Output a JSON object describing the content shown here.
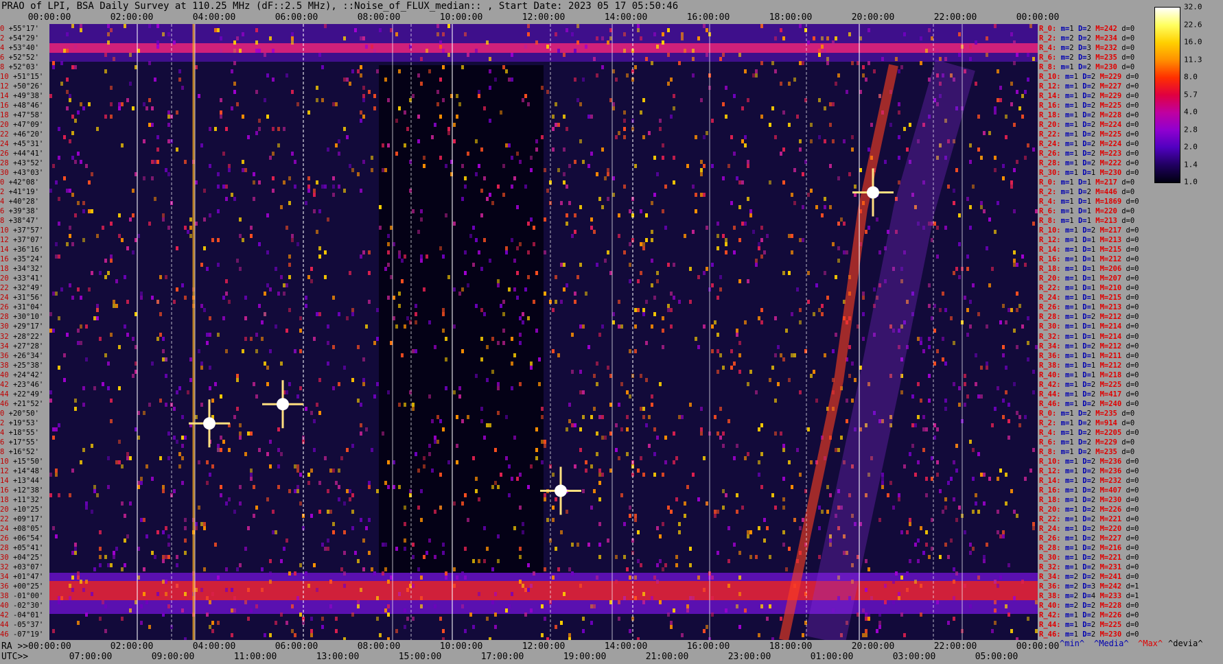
{
  "title": "PRAO of LPI, BSA Daily Survey at 110.25 MHz (dF::2.5 MHz), ::Noise_of_FLUX_median:: , Start Date: 2023 05 17 05:50:46",
  "top_times": [
    "00:00:00",
    "02:00:00",
    "04:00:00",
    "06:00:00",
    "08:00:00",
    "10:00:00",
    "12:00:00",
    "14:00:00",
    "16:00:00",
    "18:00:00",
    "20:00:00",
    "22:00:00",
    "00:00:00"
  ],
  "ra_prefix": "RA >>00:00:00",
  "ra_times": [
    "02:00:00",
    "04:00:00",
    "06:00:00",
    "08:00:00",
    "10:00:00",
    "12:00:00",
    "14:00:00",
    "16:00:00",
    "18:00:00",
    "20:00:00",
    "22:00:00",
    "00:00:00"
  ],
  "utc_prefix": "UTC>>",
  "utc_times": [
    "07:00:00",
    "09:00:00",
    "11:00:00",
    "13:00:00",
    "15:00:00",
    "17:00:00",
    "19:00:00",
    "21:00:00",
    "23:00:00",
    "01:00:00",
    "03:00:00",
    "05:00:00"
  ],
  "legend": {
    "min": "^min^",
    "median": "^Media^",
    "max": "^Max^",
    "devia": "^devia^"
  },
  "colorbar": {
    "ticks": [
      "32.0",
      "22.6",
      "16.0",
      "11.3",
      "8.0",
      "5.7",
      "4.0",
      "2.8",
      "2.0",
      "1.4",
      "1.0"
    ],
    "colors": [
      "#ffffff",
      "#ffff60",
      "#ffd000",
      "#ff9000",
      "#ff3000",
      "#e00040",
      "#c000a0",
      "#9000d0",
      "#5000c0",
      "#200060",
      "#000010"
    ]
  },
  "declinations": [
    {
      "i": "0",
      "d": "+55°17'"
    },
    {
      "i": "2",
      "d": "+54°29'"
    },
    {
      "i": "4",
      "d": "+53°40'"
    },
    {
      "i": "6",
      "d": "+52°52'"
    },
    {
      "i": "8",
      "d": "+52°03'"
    },
    {
      "i": "10",
      "d": "+51°15'"
    },
    {
      "i": "12",
      "d": "+50°26'"
    },
    {
      "i": "14",
      "d": "+49°38'"
    },
    {
      "i": "16",
      "d": "+48°46'"
    },
    {
      "i": "18",
      "d": "+47°58'"
    },
    {
      "i": "20",
      "d": "+47°09'"
    },
    {
      "i": "22",
      "d": "+46°20'"
    },
    {
      "i": "24",
      "d": "+45°31'"
    },
    {
      "i": "26",
      "d": "+44°41'"
    },
    {
      "i": "28",
      "d": "+43°52'"
    },
    {
      "i": "30",
      "d": "+43°03'"
    },
    {
      "i": "0",
      "d": "+42°08'"
    },
    {
      "i": "2",
      "d": "+41°19'"
    },
    {
      "i": "4",
      "d": "+40°28'"
    },
    {
      "i": "6",
      "d": "+39°38'"
    },
    {
      "i": "8",
      "d": "+38°47'"
    },
    {
      "i": "10",
      "d": "+37°57'"
    },
    {
      "i": "12",
      "d": "+37°07'"
    },
    {
      "i": "14",
      "d": "+36°16'"
    },
    {
      "i": "16",
      "d": "+35°24'"
    },
    {
      "i": "18",
      "d": "+34°32'"
    },
    {
      "i": "20",
      "d": "+33°41'"
    },
    {
      "i": "22",
      "d": "+32°49'"
    },
    {
      "i": "24",
      "d": "+31°56'"
    },
    {
      "i": "26",
      "d": "+31°04'"
    },
    {
      "i": "28",
      "d": "+30°10'"
    },
    {
      "i": "30",
      "d": "+29°17'"
    },
    {
      "i": "32",
      "d": "+28°22'"
    },
    {
      "i": "34",
      "d": "+27°28'"
    },
    {
      "i": "36",
      "d": "+26°34'"
    },
    {
      "i": "38",
      "d": "+25°38'"
    },
    {
      "i": "40",
      "d": "+24°42'"
    },
    {
      "i": "42",
      "d": "+23°46'"
    },
    {
      "i": "44",
      "d": "+22°49'"
    },
    {
      "i": "46",
      "d": "+21°52'"
    },
    {
      "i": "0",
      "d": "+20°50'"
    },
    {
      "i": "2",
      "d": "+19°53'"
    },
    {
      "i": "4",
      "d": "+18°55'"
    },
    {
      "i": "6",
      "d": "+17°55'"
    },
    {
      "i": "8",
      "d": "+16°52'"
    },
    {
      "i": "10",
      "d": "+15°50'"
    },
    {
      "i": "12",
      "d": "+14°48'"
    },
    {
      "i": "14",
      "d": "+13°44'"
    },
    {
      "i": "16",
      "d": "+12°38'"
    },
    {
      "i": "18",
      "d": "+11°32'"
    },
    {
      "i": "20",
      "d": "+10°25'"
    },
    {
      "i": "22",
      "d": "+09°17'"
    },
    {
      "i": "24",
      "d": "+08°05'"
    },
    {
      "i": "26",
      "d": "+06°54'"
    },
    {
      "i": "28",
      "d": "+05°41'"
    },
    {
      "i": "30",
      "d": "+04°25'"
    },
    {
      "i": "32",
      "d": "+03°07'"
    },
    {
      "i": "34",
      "d": "+01°47'"
    },
    {
      "i": "36",
      "d": "+00°25'"
    },
    {
      "i": "38",
      "d": "-01°00'"
    },
    {
      "i": "40",
      "d": "-02°30'"
    },
    {
      "i": "42",
      "d": "-04°01'"
    },
    {
      "i": "44",
      "d": "-05°37'"
    },
    {
      "i": "46",
      "d": "-07°19'"
    }
  ],
  "row_stats": [
    {
      "r": "R_0:",
      "m": "1",
      "D": "2",
      "M": "242",
      "d": "0"
    },
    {
      "r": "R_2:",
      "m": "2",
      "D": "2",
      "M": "234",
      "d": "0"
    },
    {
      "r": "R_4:",
      "m": "2",
      "D": "3",
      "M": "232",
      "d": "0"
    },
    {
      "r": "R_6:",
      "m": "2",
      "D": "3",
      "M": "235",
      "d": "0"
    },
    {
      "r": "R_8:",
      "m": "1",
      "D": "2",
      "M": "230",
      "d": "0"
    },
    {
      "r": "R_10:",
      "m": "1",
      "D": "2",
      "M": "229",
      "d": "0"
    },
    {
      "r": "R_12:",
      "m": "1",
      "D": "2",
      "M": "227",
      "d": "0"
    },
    {
      "r": "R_14:",
      "m": "1",
      "D": "2",
      "M": "229",
      "d": "0"
    },
    {
      "r": "R_16:",
      "m": "1",
      "D": "2",
      "M": "225",
      "d": "0"
    },
    {
      "r": "R_18:",
      "m": "1",
      "D": "2",
      "M": "228",
      "d": "0"
    },
    {
      "r": "R_20:",
      "m": "1",
      "D": "2",
      "M": "224",
      "d": "0"
    },
    {
      "r": "R_22:",
      "m": "1",
      "D": "2",
      "M": "225",
      "d": "0"
    },
    {
      "r": "R_24:",
      "m": "1",
      "D": "2",
      "M": "224",
      "d": "0"
    },
    {
      "r": "R_26:",
      "m": "1",
      "D": "2",
      "M": "223",
      "d": "0"
    },
    {
      "r": "R_28:",
      "m": "1",
      "D": "2",
      "M": "222",
      "d": "0"
    },
    {
      "r": "R_30:",
      "m": "1",
      "D": "1",
      "M": "230",
      "d": "0"
    },
    {
      "r": "R_0:",
      "m": "1",
      "D": "1",
      "M": "217",
      "d": "0"
    },
    {
      "r": "R_2:",
      "m": "1",
      "D": "2",
      "M": "446",
      "d": "0"
    },
    {
      "r": "R_4:",
      "m": "1",
      "D": "1",
      "M": "1869",
      "d": "0"
    },
    {
      "r": "R_6:",
      "m": "1",
      "D": "1",
      "M": "220",
      "d": "0"
    },
    {
      "r": "R_8:",
      "m": "1",
      "D": "1",
      "M": "213",
      "d": "0"
    },
    {
      "r": "R_10:",
      "m": "1",
      "D": "2",
      "M": "217",
      "d": "0"
    },
    {
      "r": "R_12:",
      "m": "1",
      "D": "1",
      "M": "213",
      "d": "0"
    },
    {
      "r": "R_14:",
      "m": "1",
      "D": "1",
      "M": "215",
      "d": "0"
    },
    {
      "r": "R_16:",
      "m": "1",
      "D": "1",
      "M": "212",
      "d": "0"
    },
    {
      "r": "R_18:",
      "m": "1",
      "D": "1",
      "M": "206",
      "d": "0"
    },
    {
      "r": "R_20:",
      "m": "1",
      "D": "1",
      "M": "207",
      "d": "0"
    },
    {
      "r": "R_22:",
      "m": "1",
      "D": "1",
      "M": "210",
      "d": "0"
    },
    {
      "r": "R_24:",
      "m": "1",
      "D": "1",
      "M": "215",
      "d": "0"
    },
    {
      "r": "R_26:",
      "m": "1",
      "D": "1",
      "M": "213",
      "d": "0"
    },
    {
      "r": "R_28:",
      "m": "1",
      "D": "2",
      "M": "212",
      "d": "0"
    },
    {
      "r": "R_30:",
      "m": "1",
      "D": "1",
      "M": "214",
      "d": "0"
    },
    {
      "r": "R_32:",
      "m": "1",
      "D": "1",
      "M": "214",
      "d": "0"
    },
    {
      "r": "R_34:",
      "m": "1",
      "D": "2",
      "M": "212",
      "d": "0"
    },
    {
      "r": "R_36:",
      "m": "1",
      "D": "1",
      "M": "211",
      "d": "0"
    },
    {
      "r": "R_38:",
      "m": "1",
      "D": "1",
      "M": "212",
      "d": "0"
    },
    {
      "r": "R_40:",
      "m": "1",
      "D": "1",
      "M": "218",
      "d": "0"
    },
    {
      "r": "R_42:",
      "m": "1",
      "D": "2",
      "M": "225",
      "d": "0"
    },
    {
      "r": "R_44:",
      "m": "1",
      "D": "2",
      "M": "417",
      "d": "0"
    },
    {
      "r": "R_46:",
      "m": "1",
      "D": "2",
      "M": "240",
      "d": "0"
    },
    {
      "r": "R_0:",
      "m": "1",
      "D": "2",
      "M": "235",
      "d": "0"
    },
    {
      "r": "R_2:",
      "m": "1",
      "D": "2",
      "M": "914",
      "d": "0"
    },
    {
      "r": "R_4:",
      "m": "1",
      "D": "2",
      "M": "2205",
      "d": "0"
    },
    {
      "r": "R_6:",
      "m": "1",
      "D": "2",
      "M": "229",
      "d": "0"
    },
    {
      "r": "R_8:",
      "m": "1",
      "D": "2",
      "M": "235",
      "d": "0"
    },
    {
      "r": "R_10:",
      "m": "1",
      "D": "2",
      "M": "236",
      "d": "0"
    },
    {
      "r": "R_12:",
      "m": "1",
      "D": "2",
      "M": "236",
      "d": "0"
    },
    {
      "r": "R_14:",
      "m": "1",
      "D": "2",
      "M": "232",
      "d": "0"
    },
    {
      "r": "R_16:",
      "m": "1",
      "D": "2",
      "M": "407",
      "d": "0"
    },
    {
      "r": "R_18:",
      "m": "1",
      "D": "2",
      "M": "230",
      "d": "0"
    },
    {
      "r": "R_20:",
      "m": "1",
      "D": "2",
      "M": "226",
      "d": "0"
    },
    {
      "r": "R_22:",
      "m": "1",
      "D": "2",
      "M": "221",
      "d": "0"
    },
    {
      "r": "R_24:",
      "m": "1",
      "D": "2",
      "M": "220",
      "d": "0"
    },
    {
      "r": "R_26:",
      "m": "1",
      "D": "2",
      "M": "227",
      "d": "0"
    },
    {
      "r": "R_28:",
      "m": "1",
      "D": "2",
      "M": "216",
      "d": "0"
    },
    {
      "r": "R_30:",
      "m": "1",
      "D": "2",
      "M": "221",
      "d": "0"
    },
    {
      "r": "R_32:",
      "m": "1",
      "D": "2",
      "M": "231",
      "d": "0"
    },
    {
      "r": "R_34:",
      "m": "2",
      "D": "2",
      "M": "241",
      "d": "0"
    },
    {
      "r": "R_36:",
      "m": "2",
      "D": "3",
      "M": "242",
      "d": "1"
    },
    {
      "r": "R_38:",
      "m": "2",
      "D": "4",
      "M": "233",
      "d": "1"
    },
    {
      "r": "R_40:",
      "m": "2",
      "D": "2",
      "M": "228",
      "d": "0"
    },
    {
      "r": "R_42:",
      "m": "1",
      "D": "2",
      "M": "226",
      "d": "0"
    },
    {
      "r": "R_44:",
      "m": "1",
      "D": "2",
      "M": "225",
      "d": "0"
    },
    {
      "r": "R_46:",
      "m": "1",
      "D": "2",
      "M": "230",
      "d": "0"
    }
  ],
  "chart_data": {
    "type": "heatmap",
    "title": "PRAO of LPI, BSA Daily Survey at 110.25 MHz (dF::2.5 MHz), ::Noise_of_FLUX_median:: , Start Date: 2023 05 17 05:50:46",
    "x_axis": {
      "local_sidereal_time": [
        "00:00:00",
        "02:00:00",
        "04:00:00",
        "06:00:00",
        "08:00:00",
        "10:00:00",
        "12:00:00",
        "14:00:00",
        "16:00:00",
        "18:00:00",
        "20:00:00",
        "22:00:00",
        "00:00:00"
      ],
      "utc": [
        "07:00:00",
        "09:00:00",
        "11:00:00",
        "13:00:00",
        "15:00:00",
        "17:00:00",
        "19:00:00",
        "21:00:00",
        "23:00:00",
        "01:00:00",
        "03:00:00",
        "05:00:00"
      ]
    },
    "y_axis": {
      "label_range": [
        "+55°17'",
        "-07°19'"
      ]
    },
    "color_scale": {
      "min": 1.0,
      "max": 32.0,
      "log": true
    },
    "bright_sources": [
      {
        "ra": "03:53",
        "dec": "+19°53'"
      },
      {
        "ra": "05:40",
        "dec": "+21°52'"
      },
      {
        "ra": "20:00",
        "dec": "+41°19'"
      },
      {
        "ra": "12:25",
        "dec": "+12°38'"
      }
    ]
  }
}
